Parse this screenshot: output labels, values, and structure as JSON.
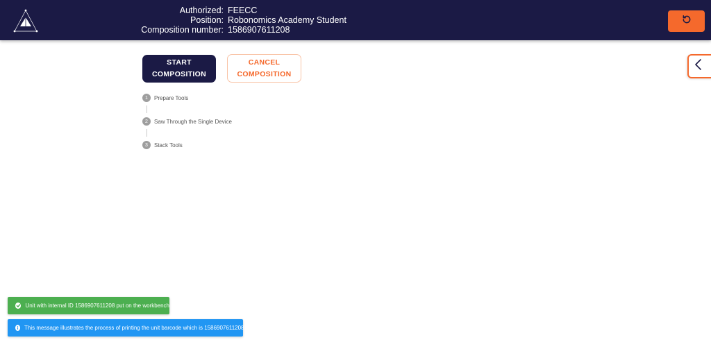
{
  "header": {
    "labels": {
      "authorized": "Authorized:",
      "position": "Position:",
      "composition_number": "Composition number:"
    },
    "values": {
      "authorized": "FEECC",
      "position": "Robonomics Academy Student",
      "composition_number": "1586907611208"
    },
    "logo_icon": "triangle-constellation-logo",
    "reset_icon": "rotate-ccw-icon"
  },
  "actions": {
    "start": {
      "line1": "START",
      "line2": "COMPOSITION"
    },
    "cancel": {
      "line1": "CANCEL",
      "line2": "COMPOSITION"
    }
  },
  "side_toggle_icon": "chevron-left-icon",
  "steps": [
    {
      "num": "1",
      "label": "Prepare Tools"
    },
    {
      "num": "2",
      "label": "Saw Through the Single Device"
    },
    {
      "num": "3",
      "label": "Stack Tools"
    }
  ],
  "notifications": [
    {
      "type": "success",
      "icon": "check-circle-icon",
      "message": "Unit with internal ID 1586907611208 put on the workbench"
    },
    {
      "type": "info",
      "icon": "info-circle-icon",
      "message": "This message illustrates the process of printing the unit barcode which is 1586907611208"
    }
  ],
  "colors": {
    "navy": "#1b1a45",
    "accent": "#f5692c",
    "success": "#4caf50",
    "info": "#2196f3"
  }
}
